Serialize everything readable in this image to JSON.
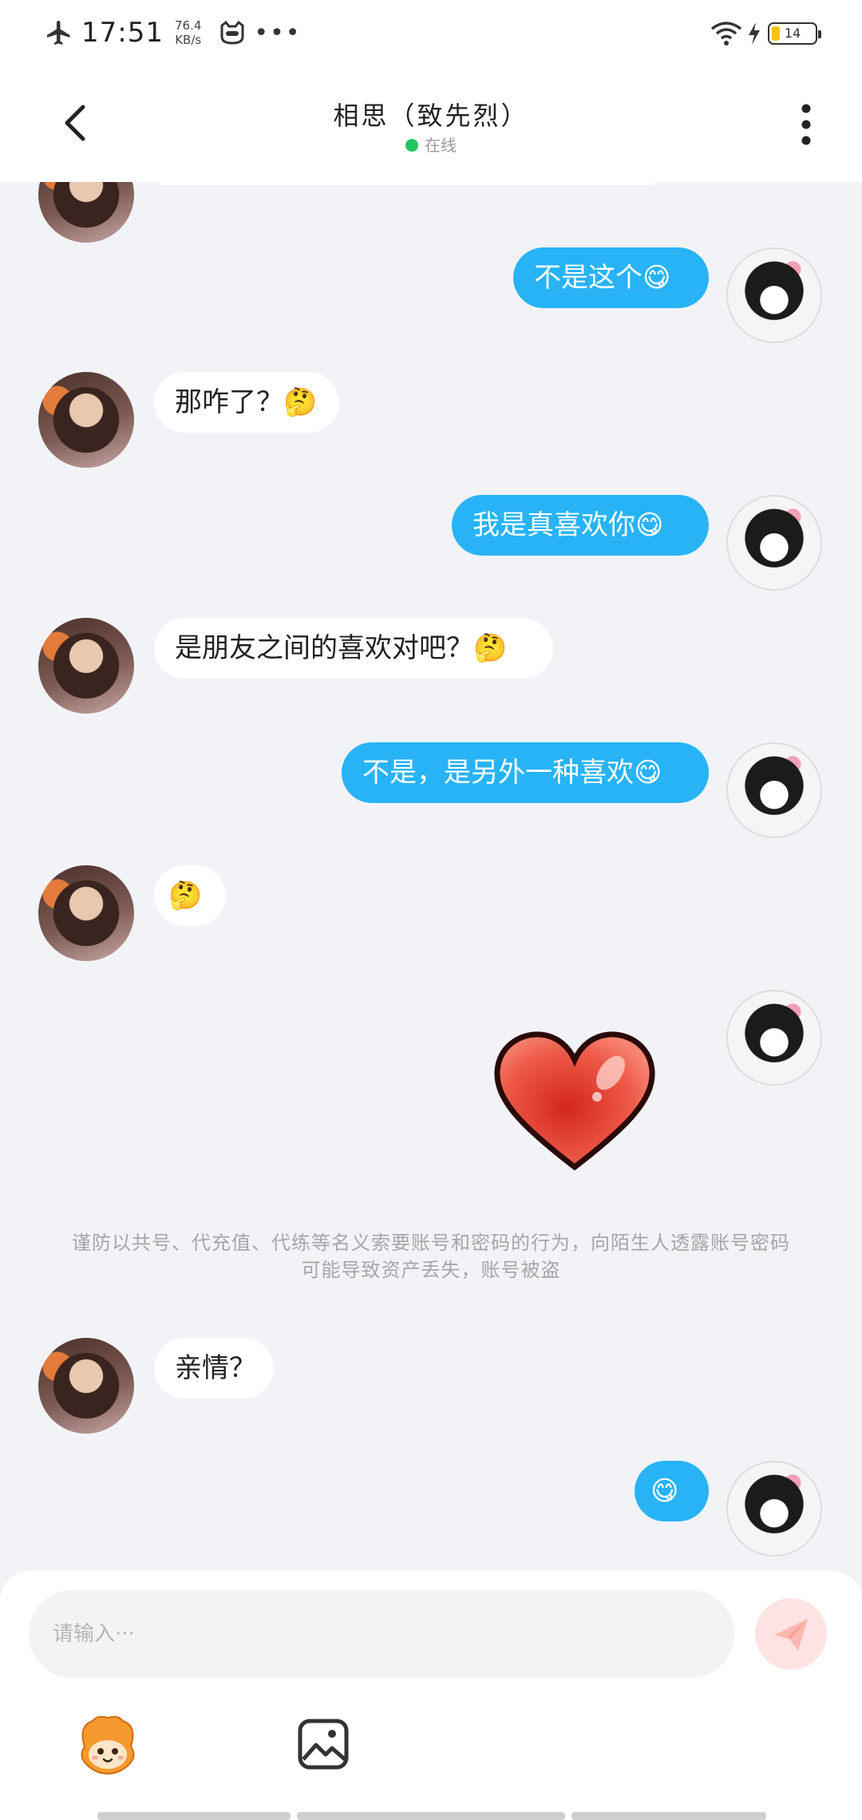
{
  "status_bar": {
    "time": "17:51",
    "net_speed_value": "76.4",
    "net_speed_unit": "KB/s",
    "dots": "•••",
    "battery": "14"
  },
  "header": {
    "title": "相思（致先烈）",
    "status": "在线"
  },
  "messages": [
    {
      "side": "out",
      "text": "不是这个😋"
    },
    {
      "side": "in",
      "text": "那咋了？🤔"
    },
    {
      "side": "out",
      "text": "我是真喜欢你😋"
    },
    {
      "side": "in",
      "text": "是朋友之间的喜欢对吧？🤔"
    },
    {
      "side": "out",
      "text": "不是，是另外一种喜欢😋"
    },
    {
      "side": "in",
      "text": "🤔"
    },
    {
      "side": "in",
      "text": "亲情？"
    },
    {
      "side": "out",
      "text": "😋"
    }
  ],
  "notice": "谨防以共号、代充值、代练等名义索要账号和密码的行为，向陌生人透露账号密码可能导致资产丢失，账号被盗",
  "composer": {
    "placeholder": "请输入···"
  },
  "colors": {
    "outgoing_bubble": "#27b3f5",
    "incoming_bubble": "#ffffff",
    "online_dot": "#22c55e",
    "send_button": "#fde4e2"
  }
}
